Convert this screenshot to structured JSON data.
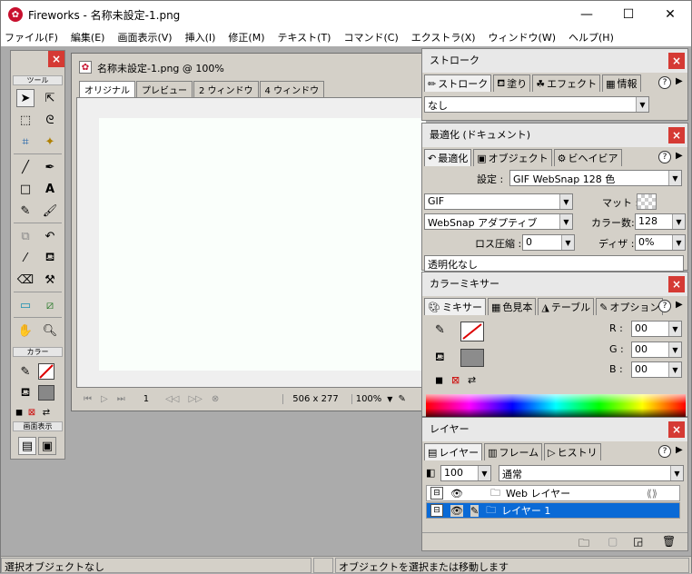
{
  "app": {
    "title": "Fireworks - 名称未設定-1.png"
  },
  "window_controls": {
    "minimize": "—",
    "maximize": "☐",
    "close": "✕"
  },
  "menu": [
    "ファイル(F)",
    "編集(E)",
    "画面表示(V)",
    "挿入(I)",
    "修正(M)",
    "テキスト(T)",
    "コマンド(C)",
    "エクストラ(X)",
    "ウィンドウ(W)",
    "ヘルプ(H)"
  ],
  "tools": {
    "title": "ツール",
    "color_section": "カラー",
    "view_section": "画面表示"
  },
  "document": {
    "title": "名称未設定-1.png @  100%",
    "tabs": [
      "オリジナル",
      "プレビュー",
      "2 ウィンドウ",
      "4 ウィンドウ"
    ],
    "frame": "1",
    "size": "506 x 277",
    "zoom": "100%"
  },
  "stroke_panel": {
    "title": "ストローク",
    "tabs": [
      "ストローク",
      "塗り",
      "エフェクト",
      "情報"
    ],
    "value": "なし"
  },
  "optimize_panel": {
    "title": "最適化 (ドキュメント)",
    "tabs": [
      "最適化",
      "オブジェクト",
      "ビヘイビア"
    ],
    "settings_label": "設定 :",
    "settings_value": "GIF WebSnap 128 色",
    "format": "GIF",
    "matte_label": "マット :",
    "palette": "WebSnap アダプティブ",
    "colors_label": "カラー数:",
    "colors_value": "128",
    "loss_label": "ロス圧縮 :",
    "loss_value": "0",
    "dither_label": "ディザ :",
    "dither_value": "0%",
    "transparency": "透明化なし"
  },
  "mixer_panel": {
    "title": "カラーミキサー",
    "tabs": [
      "ミキサー",
      "色見本",
      "テーブル",
      "オプション"
    ],
    "r_label": "R :",
    "r_value": "00",
    "g_label": "G :",
    "g_value": "00",
    "b_label": "B :",
    "b_value": "00"
  },
  "layers_panel": {
    "title": "レイヤー",
    "tabs": [
      "レイヤー",
      "フレーム",
      "ヒストリ"
    ],
    "opacity": "100",
    "blend": "通常",
    "layers": [
      "Web レイヤー",
      "レイヤー 1"
    ]
  },
  "status": {
    "left": "選択オブジェクトなし",
    "right": "オブジェクトを選択または移動します"
  },
  "colors": {
    "accent": "#0a6ad6",
    "close": "#d53a34"
  }
}
